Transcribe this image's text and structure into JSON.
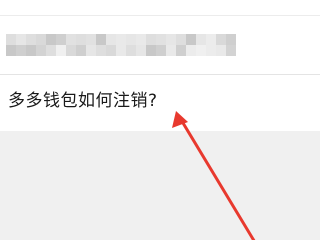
{
  "question": {
    "title": "多多钱包如何注销?"
  },
  "annotation": {
    "arrow_color": "#e8392e",
    "icon": "red-arrow-icon"
  },
  "colors": {
    "background": "#f0f0f0",
    "card": "#ffffff",
    "text": "#1a1a1a"
  }
}
